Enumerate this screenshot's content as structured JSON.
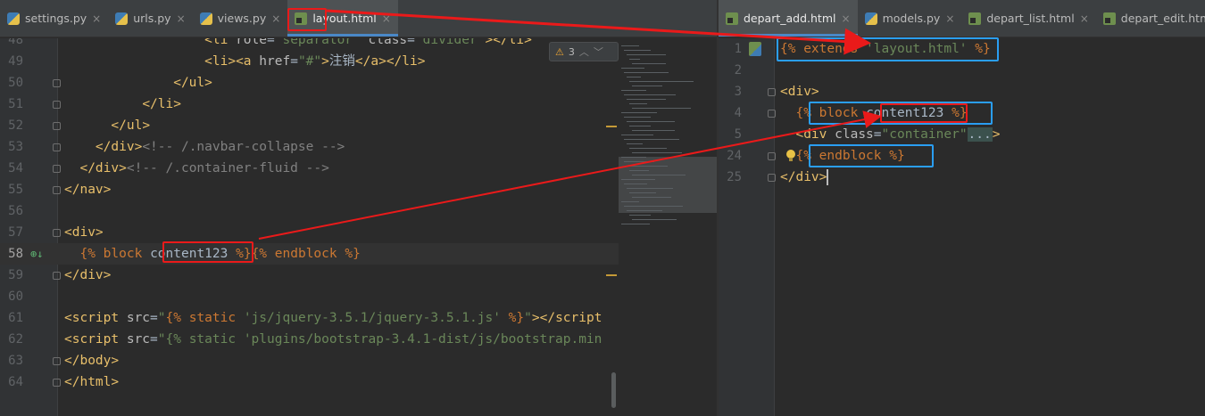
{
  "left_tabs": [
    {
      "label": "settings.py",
      "icon": "python-file-icon",
      "active": false
    },
    {
      "label": "urls.py",
      "icon": "python-file-icon",
      "active": false
    },
    {
      "label": "views.py",
      "icon": "python-file-icon",
      "active": false
    },
    {
      "label": "layout.html",
      "icon": "html-file-icon",
      "active": true
    }
  ],
  "right_tabs": [
    {
      "label": "depart_add.html",
      "icon": "html-file-icon",
      "active": true
    },
    {
      "label": "models.py",
      "icon": "python-file-icon",
      "active": false
    },
    {
      "label": "depart_list.html",
      "icon": "html-file-icon",
      "active": false
    },
    {
      "label": "depart_edit.html",
      "icon": "html-file-icon",
      "active": false
    }
  ],
  "inspection_widget": {
    "count": "3",
    "icon": "warning-icon"
  },
  "left_editor": {
    "lines": [
      {
        "num": "48",
        "text": "                  <li role=\"separator\" class=\"divider\"></li>"
      },
      {
        "num": "49",
        "text": "                  <li><a href=\"#\">注销</a></li>"
      },
      {
        "num": "50",
        "text": "              </ul>"
      },
      {
        "num": "51",
        "text": "          </li>"
      },
      {
        "num": "52",
        "text": "      </ul>"
      },
      {
        "num": "53",
        "text": "    </div><!-- /.navbar-collapse -->"
      },
      {
        "num": "54",
        "text": "  </div><!-- /.container-fluid -->"
      },
      {
        "num": "55",
        "text": "</nav>"
      },
      {
        "num": "56",
        "text": ""
      },
      {
        "num": "57",
        "text": "<div>"
      },
      {
        "num": "58",
        "text": "  {% block content123 %}{% endblock %}"
      },
      {
        "num": "59",
        "text": "</div>"
      },
      {
        "num": "60",
        "text": ""
      },
      {
        "num": "61",
        "text": "<script src=\"{% static 'js/jquery-3.5.1/jquery-3.5.1.js' %}\"></script"
      },
      {
        "num": "62",
        "text": "<script src=\"{% static 'plugins/bootstrap-3.4.1-dist/js/bootstrap.min"
      },
      {
        "num": "63",
        "text": "</body>"
      },
      {
        "num": "64",
        "text": "</html>"
      }
    ]
  },
  "right_editor": {
    "lines": [
      {
        "num": "1",
        "text": "{% extends 'layout.html' %}"
      },
      {
        "num": "2",
        "text": ""
      },
      {
        "num": "3",
        "text": "<div>"
      },
      {
        "num": "4",
        "text": "  {% block content123 %}"
      },
      {
        "num": "5",
        "text": "  <div class=\"container\"...>"
      },
      {
        "num": "24",
        "text": "  {% endblock %}"
      },
      {
        "num": "25",
        "text": "</div>"
      }
    ]
  },
  "colors": {
    "annotation_red": "#ea1a1a",
    "annotation_blue": "#2a9ef2",
    "tab_active_underline": "#4a88c7",
    "html_tag": "#e8bf6a",
    "string": "#6a8759",
    "template_keyword": "#cc7832"
  }
}
